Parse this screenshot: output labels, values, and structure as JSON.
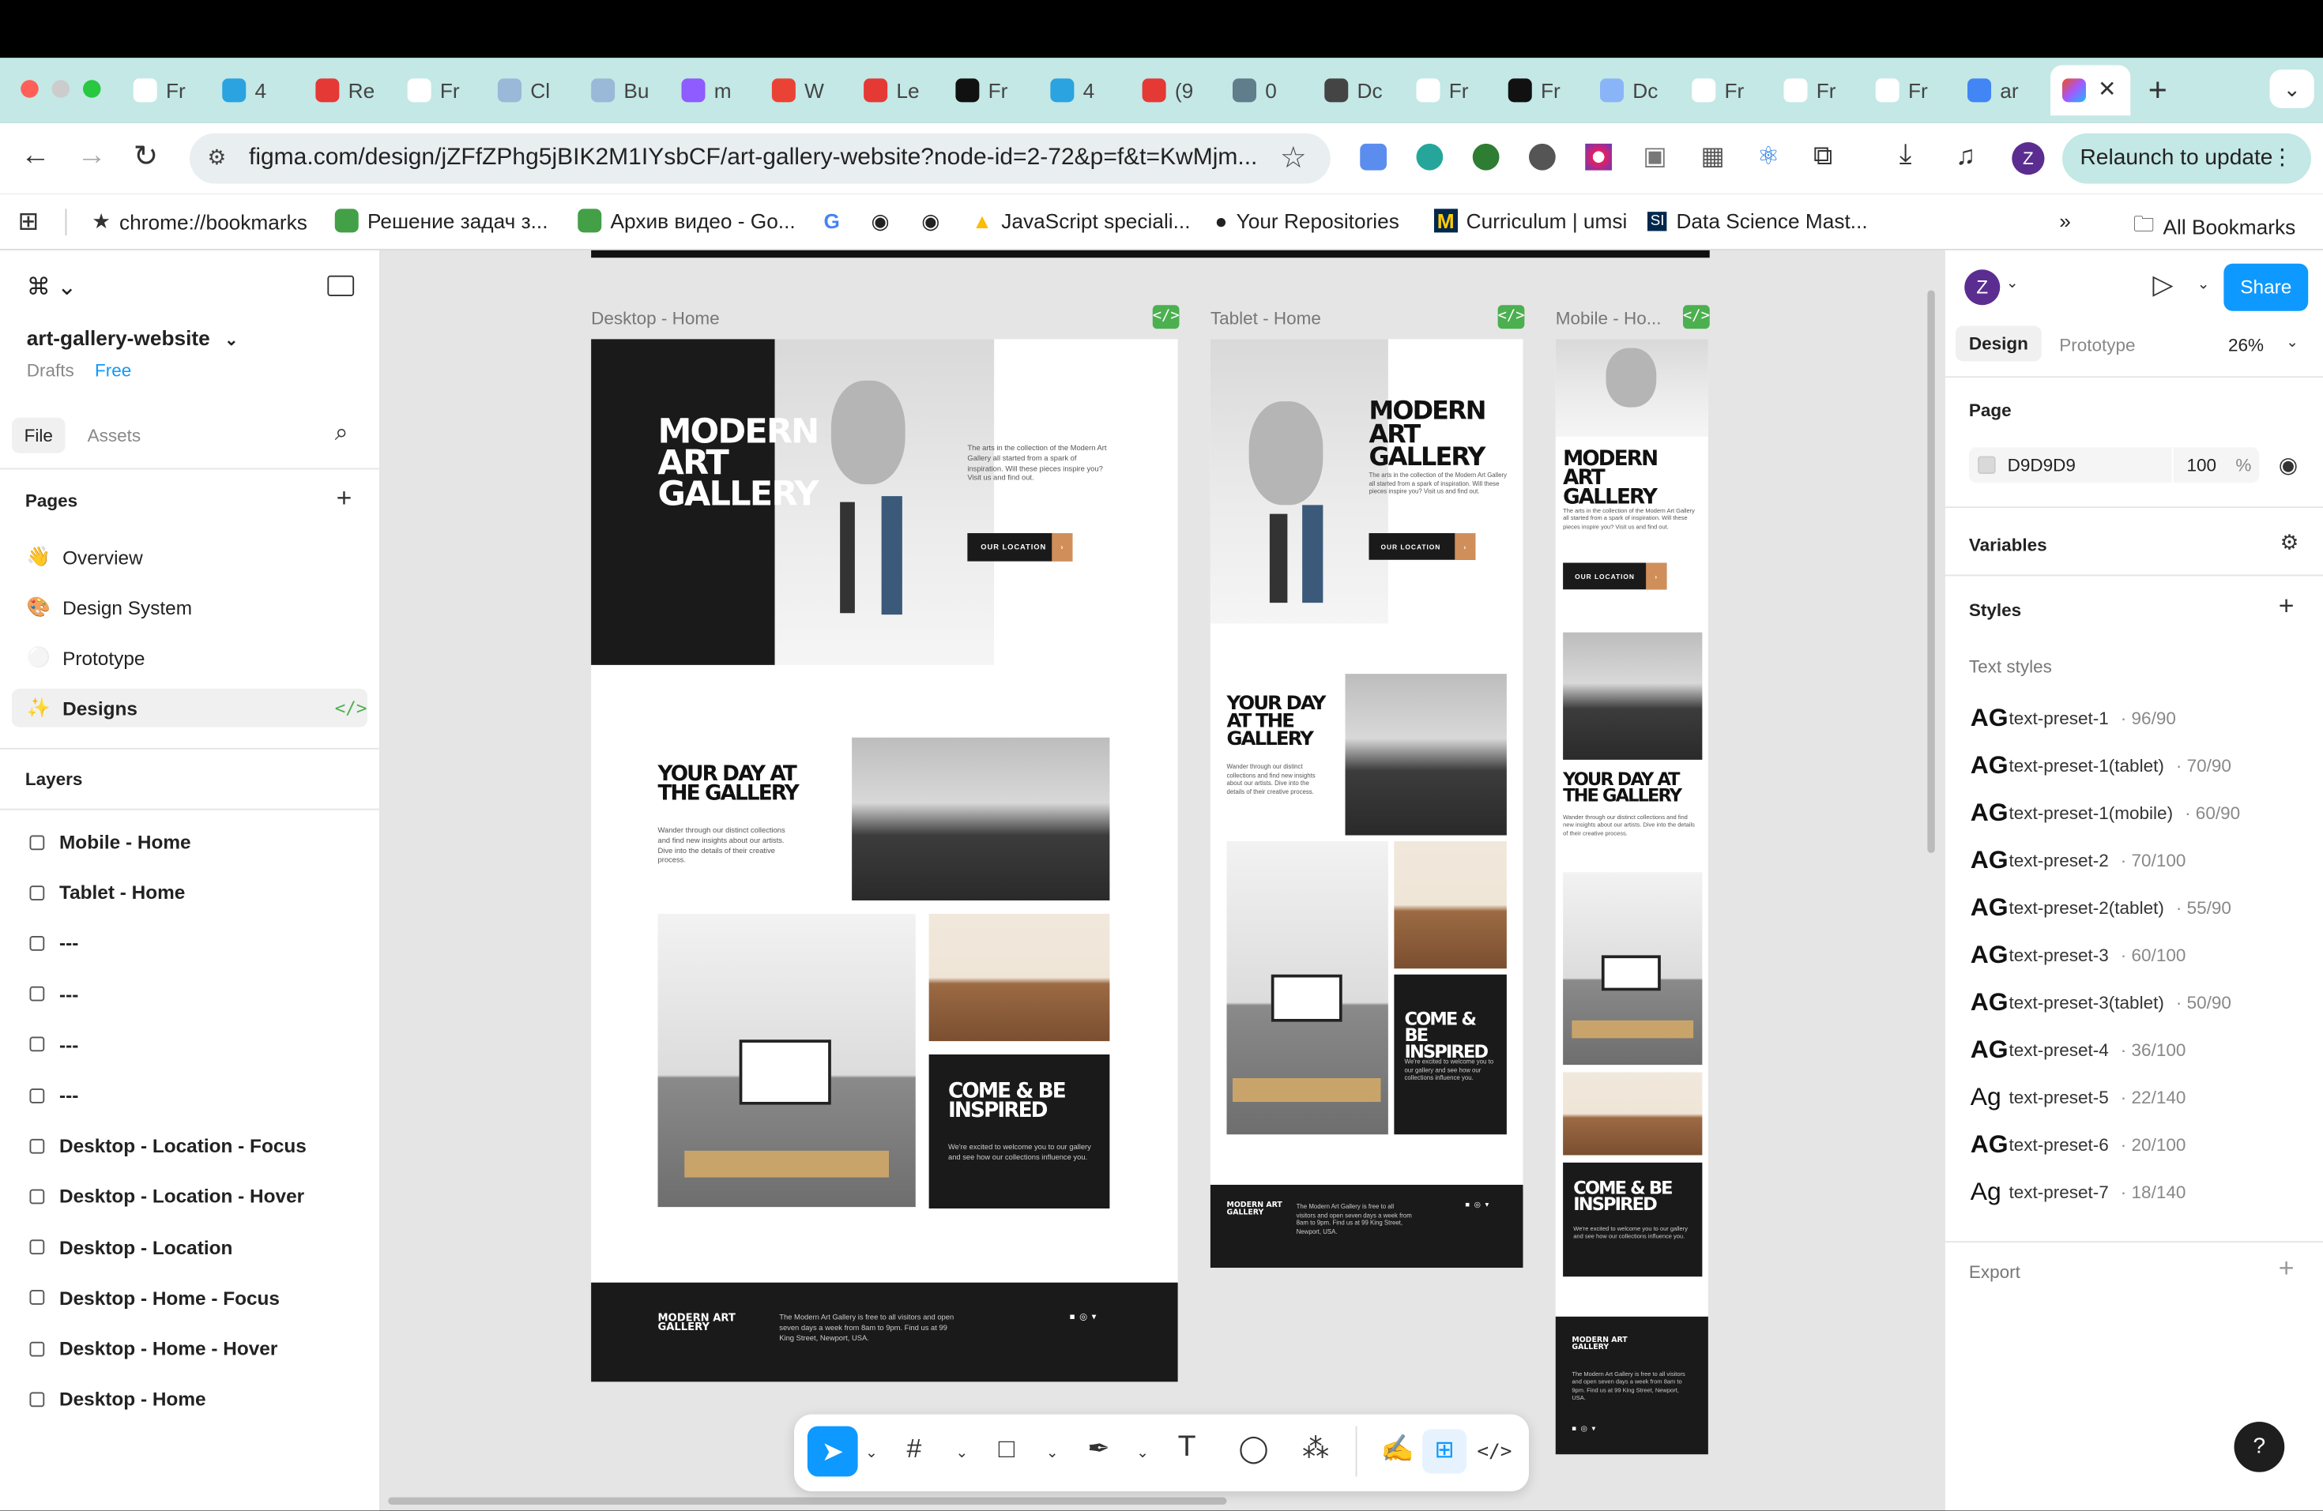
{
  "browser": {
    "tabs": [
      "Fr",
      "4",
      "Re",
      "Fr",
      "Cl",
      "Bu",
      "m",
      "W",
      "Le",
      "Fr",
      "4",
      "(9",
      "0",
      "Dc",
      "Fr",
      "Fr",
      "Dc",
      "Fr",
      "Fr",
      "Fr",
      "ar"
    ],
    "active_tab_close": "✕",
    "new_tab": "+",
    "url": "figma.com/design/jZFfZPhg5jBIK2M1IYsbCF/art-gallery-website?node-id=2-72&p=f&t=KwMjm...",
    "relaunch": "Relaunch to update",
    "profile": "Z",
    "bookmarks": [
      "chrome://bookmarks",
      "Решение задач з...",
      "Архив видео - Go...",
      "JavaScript speciali...",
      "Your Repositories",
      "Curriculum | umsi",
      "Data Science Mast..."
    ],
    "all_bookmarks": "All Bookmarks"
  },
  "left": {
    "file_name": "art-gallery-website",
    "drafts": "Drafts",
    "plan": "Free",
    "tab_file": "File",
    "tab_assets": "Assets",
    "pages_title": "Pages",
    "pages": [
      {
        "emoji": "👋",
        "label": "Overview"
      },
      {
        "emoji": "🎨",
        "label": "Design System"
      },
      {
        "emoji": "⚪",
        "label": "Prototype"
      },
      {
        "emoji": "✨",
        "label": "Designs"
      }
    ],
    "layers_title": "Layers",
    "layers": [
      "Mobile - Home",
      "Tablet  - Home",
      "---",
      "---",
      "---",
      "---",
      "Desktop - Location - Focus",
      "Desktop - Location - Hover",
      "Desktop - Location",
      "Desktop - Home - Focus",
      "Desktop - Home - Hover",
      "Desktop - Home"
    ]
  },
  "right": {
    "avatar": "Z",
    "share": "Share",
    "tab_design": "Design",
    "tab_prototype": "Prototype",
    "zoom": "26%",
    "page_title": "Page",
    "page_color": "D9D9D9",
    "page_opacity": "100",
    "page_pct": "%",
    "variables": "Variables",
    "styles": "Styles",
    "text_styles": "Text styles",
    "styles_list": [
      {
        "glyph": "AG",
        "name": "text-preset-1",
        "size": "· 96/90"
      },
      {
        "glyph": "AG",
        "name": "text-preset-1(tablet)",
        "size": "· 70/90"
      },
      {
        "glyph": "AG",
        "name": "text-preset-1(mobile)",
        "size": "· 60/90"
      },
      {
        "glyph": "AG",
        "name": "text-preset-2",
        "size": "· 70/100"
      },
      {
        "glyph": "AG",
        "name": "text-preset-2(tablet)",
        "size": "· 55/90"
      },
      {
        "glyph": "AG",
        "name": "text-preset-3",
        "size": "· 60/100"
      },
      {
        "glyph": "AG",
        "name": "text-preset-3(tablet)",
        "size": "· 50/90"
      },
      {
        "glyph": "AG",
        "name": "text-preset-4",
        "size": "· 36/100"
      },
      {
        "glyph": "Ag",
        "name": "text-preset-5",
        "size": "· 22/140"
      },
      {
        "glyph": "AG",
        "name": "text-preset-6",
        "size": "· 20/100"
      },
      {
        "glyph": "Ag",
        "name": "text-preset-7",
        "size": "· 18/140"
      }
    ],
    "export": "Export",
    "help": "?"
  },
  "canvas": {
    "frame_desktop": "Desktop - Home",
    "frame_tablet": "Tablet  - Home",
    "frame_mobile": "Mobile - Ho...",
    "hero_title": "MODERN ART GALLERY",
    "hero_text": "The arts in the collection of the Modern Art Gallery all started from a spark of inspiration. Will these pieces inspire you? Visit us and find out.",
    "cta": "OUR LOCATION",
    "day_title": "YOUR DAY AT THE GALLERY",
    "day_text": "Wander through our distinct collections and find new insights about our artists. Dive into the details of their creative process.",
    "inspired_title": "COME & BE INSPIRED",
    "inspired_text": "We're excited to welcome you to our gallery and see how our collections influence you.",
    "footer_logo": "MODERN ART GALLERY",
    "footer_text": "The Modern Art Gallery is free to all visitors and open seven days a week from 8am to 9pm. Find us at 99 King Street, Newport, USA."
  }
}
